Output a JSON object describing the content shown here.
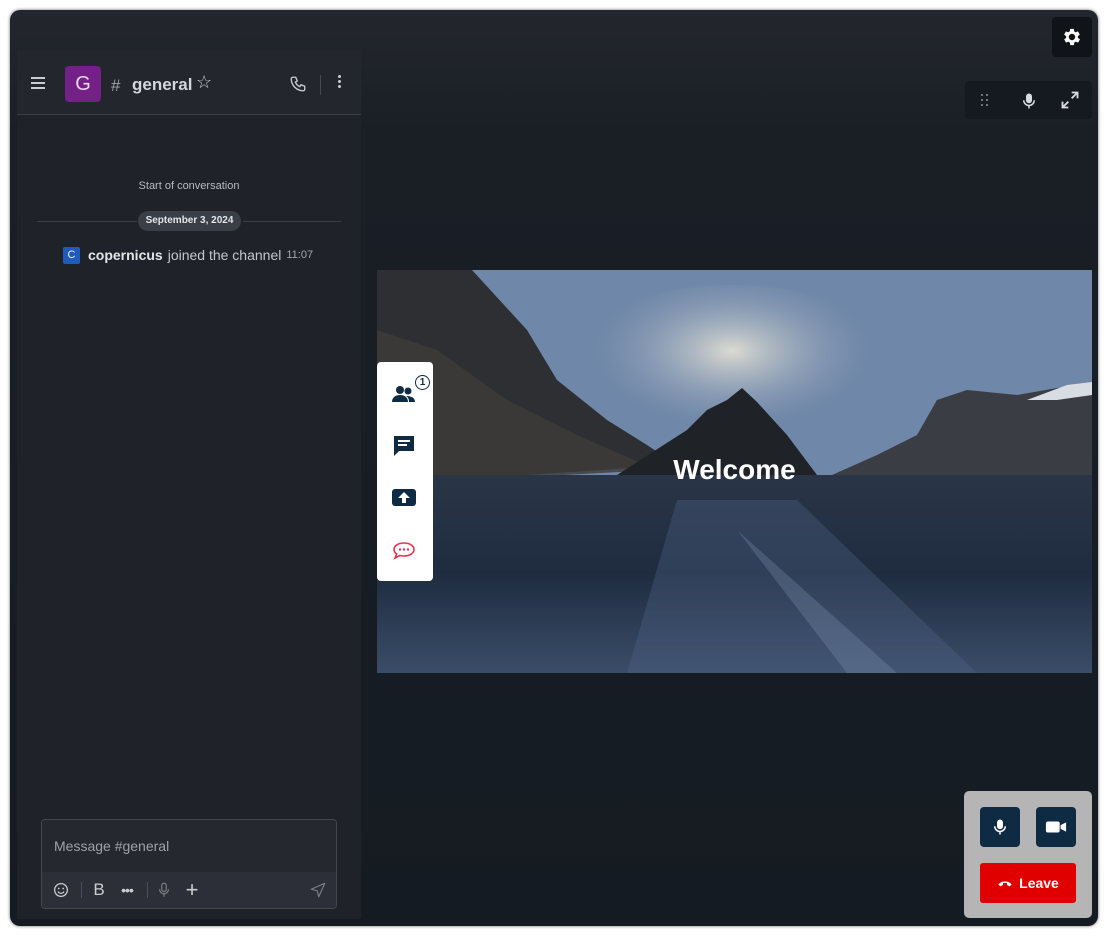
{
  "chat": {
    "room_initial": "G",
    "room_name": "general",
    "start_label": "Start of conversation",
    "date_divider": "September 3, 2024",
    "messages": [
      {
        "avatar_initial": "C",
        "user": "copernicus",
        "action": "joined the channel",
        "time": "11:07"
      }
    ],
    "composer_placeholder": "Message #general"
  },
  "stage": {
    "welcome_text": "Welcome",
    "participants_count": "1"
  },
  "call": {
    "leave_label": "Leave"
  },
  "colors": {
    "room_avatar": "#742087",
    "user_avatar": "#1d5cbb",
    "leave": "#e00000",
    "call_button": "#0f2a43"
  },
  "icons": [
    "menu-icon",
    "hash-icon",
    "star-icon",
    "phone-icon",
    "kebab-menu-icon",
    "emoji-icon",
    "bold-icon",
    "more-icon",
    "microphone-icon",
    "plus-icon",
    "send-icon",
    "gear-icon",
    "drag-handle-icon",
    "fullscreen-icon",
    "participants-icon",
    "chat-icon",
    "share-screen-icon",
    "rocket-chat-icon",
    "camera-icon",
    "hangup-icon"
  ]
}
